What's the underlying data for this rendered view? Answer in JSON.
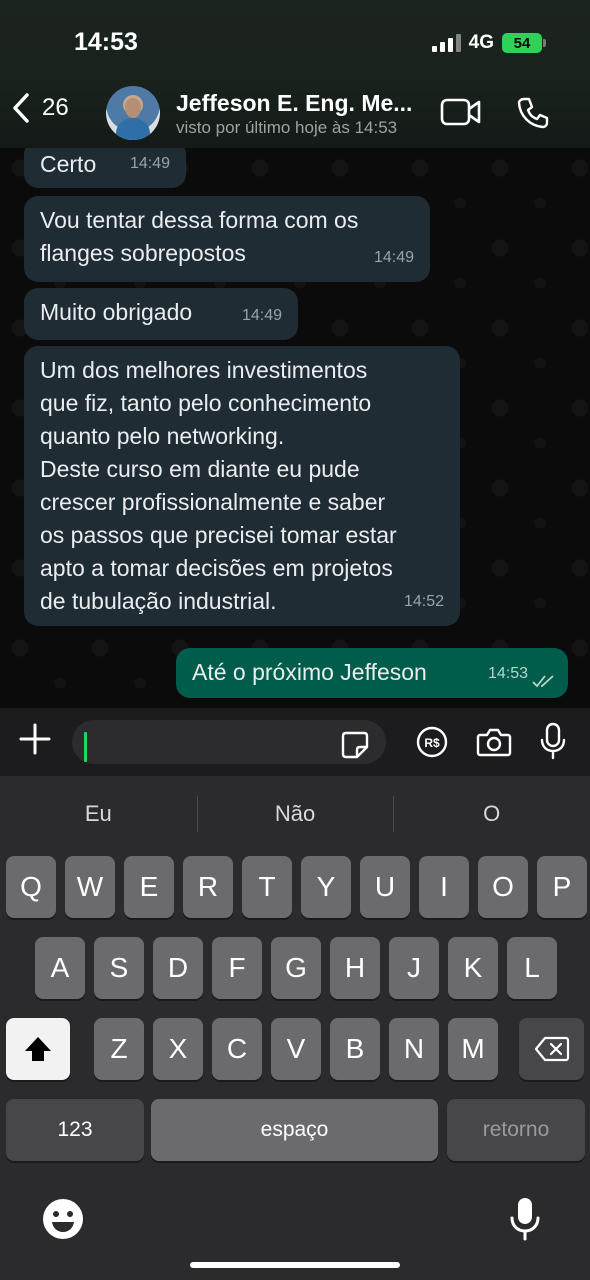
{
  "status_bar": {
    "time": "14:53",
    "network": "4G",
    "battery": "54"
  },
  "header": {
    "back_count": "26",
    "contact_name": "Jeffeson E. Eng. Me...",
    "contact_status": "visto por último hoje às 14:53"
  },
  "messages": [
    {
      "direction": "in",
      "text": "Certo",
      "time": "14:49"
    },
    {
      "direction": "in",
      "text": "Vou tentar dessa forma com os\nflanges sobrepostos",
      "time": "14:49"
    },
    {
      "direction": "in",
      "text": "Muito obrigado",
      "time": "14:49"
    },
    {
      "direction": "in",
      "text": "Um dos melhores investimentos\nque fiz, tanto pelo conhecimento\nquanto pelo networking.\nDeste curso em diante eu pude\ncrescer profissionalmente e saber\nos passos que precisei tomar estar\napto a tomar decisões em projetos\nde tubulação industrial.",
      "time": "14:52"
    },
    {
      "direction": "out",
      "text": "Até o próximo Jeffeson",
      "time": "14:53",
      "status": "read"
    }
  ],
  "composer": {
    "value": "",
    "icons": [
      "plus-icon",
      "sticker-icon",
      "pix-icon",
      "camera-icon",
      "microphone-icon"
    ]
  },
  "keyboard": {
    "suggestions": [
      "Eu",
      "Não",
      "O"
    ],
    "row1": [
      "Q",
      "W",
      "E",
      "R",
      "T",
      "Y",
      "U",
      "I",
      "O",
      "P"
    ],
    "row2": [
      "A",
      "S",
      "D",
      "F",
      "G",
      "H",
      "J",
      "K",
      "L"
    ],
    "row3": [
      "Z",
      "X",
      "C",
      "V",
      "B",
      "N",
      "M"
    ],
    "numbers_label": "123",
    "space_label": "espaço",
    "return_label": "retorno"
  },
  "colors": {
    "incoming_bubble": "#202c33",
    "outgoing_bubble": "#005c4b",
    "accent": "#25d366",
    "battery": "#30d158"
  }
}
